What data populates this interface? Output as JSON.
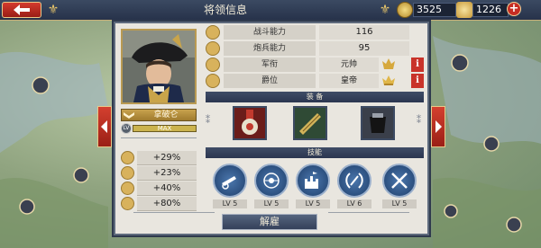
{
  "header": {
    "title": "将领信息",
    "gold": "3525",
    "medals": "1226",
    "plus_label": "+"
  },
  "general": {
    "name": "拿破仑",
    "level_label": "LV",
    "level_bar_text": "MAX",
    "level_progress": 1.0
  },
  "bonuses": [
    {
      "icon": "sword-bonus-icon",
      "value": "+29%"
    },
    {
      "icon": "cannon-bonus-icon",
      "value": "+23%"
    },
    {
      "icon": "horse-bonus-icon",
      "value": "+40%"
    },
    {
      "icon": "shield-bonus-icon",
      "value": "+80%"
    }
  ],
  "stats": [
    {
      "icon": "battle-icon",
      "label": "战斗能力",
      "value": "116"
    },
    {
      "icon": "artillery-icon",
      "label": "炮兵能力",
      "value": "95"
    },
    {
      "icon": "rank-icon",
      "label": "军衔",
      "value": "元帅",
      "info": "i"
    },
    {
      "icon": "title-icon",
      "label": "爵位",
      "value": "皇帝",
      "info": "i"
    }
  ],
  "equipment": {
    "heading": "装 备",
    "items": [
      "medal-equipment",
      "telescope-equipment",
      "pouch-equipment"
    ]
  },
  "skills": {
    "heading": "技能",
    "items": [
      {
        "icon": "cannon-skill-icon",
        "level": "LV 5"
      },
      {
        "icon": "target-skill-icon",
        "level": "LV 5"
      },
      {
        "icon": "fort-skill-icon",
        "level": "LV 5"
      },
      {
        "icon": "laurel-skill-icon",
        "level": "LV 6"
      },
      {
        "icon": "crossed-swords-skill-icon",
        "level": "LV 5"
      }
    ]
  },
  "actions": {
    "dismiss_label": "解雇"
  },
  "colors": {
    "accent_red": "#c9332a",
    "gold": "#c8a24d",
    "panel_navy": "#2b3650",
    "skill_blue": "#1f3f6b"
  }
}
